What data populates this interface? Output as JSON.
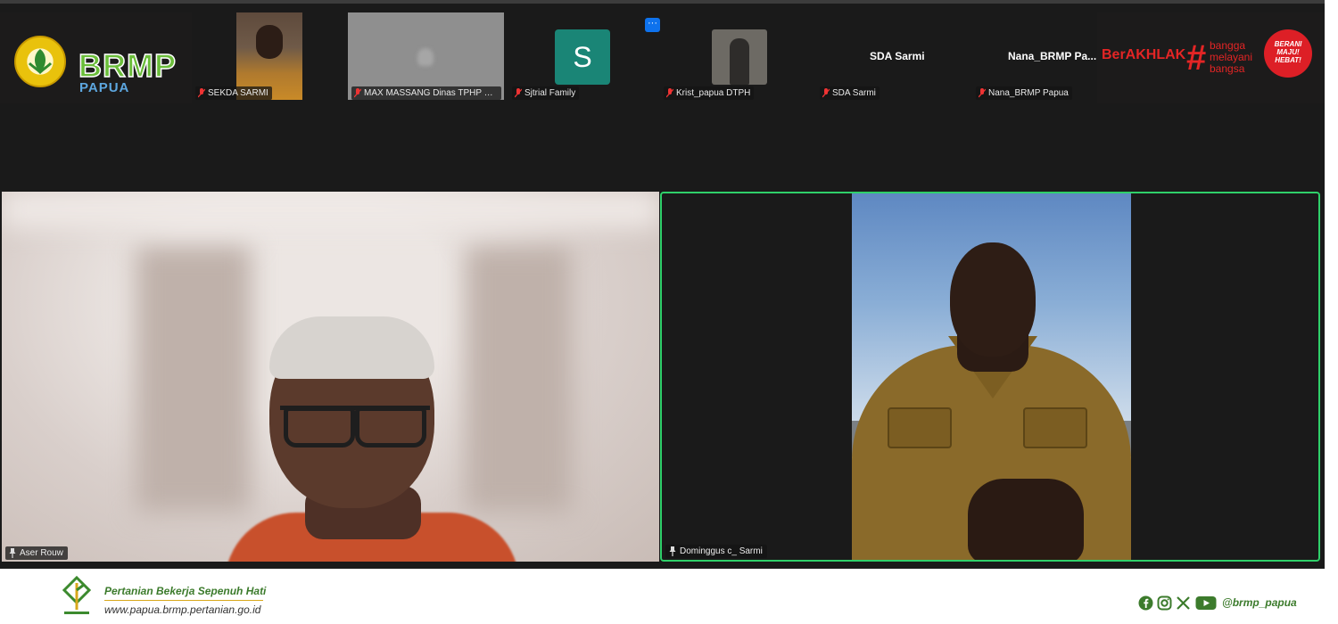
{
  "branding": {
    "left_logo": "BRMP",
    "left_sub": "PAPUA",
    "right_berakhlak": "BerAKHLAK",
    "right_bangga": [
      "bangga",
      "melayani",
      "bangsa"
    ],
    "right_berani": [
      "BERANI",
      "MAJU!",
      "HEBAT!"
    ]
  },
  "participants": [
    {
      "name": "SEKDA SARMI",
      "muted": true,
      "video": "camera"
    },
    {
      "name": "MAX  MASSANG Dinas TPHP Pa...",
      "muted": true,
      "video": "camera-off"
    },
    {
      "name": "Sjtrial Family",
      "muted": true,
      "video": "avatar",
      "avatar_letter": "S"
    },
    {
      "name": "Krist_papua DTPH",
      "muted": true,
      "video": "thumbnail"
    },
    {
      "name": "SDA Sarmi",
      "muted": true,
      "video": "name-only",
      "display_label": "SDA Sarmi"
    },
    {
      "name": "Nana_BRMP Papua",
      "muted": true,
      "video": "name-only",
      "display_label": "Nana_BRMP  Pa..."
    }
  ],
  "more_button": "···",
  "main_tiles": [
    {
      "name": "Aser Rouw",
      "pinned": true,
      "active_speaker": false
    },
    {
      "name": "Dominggus c_ Sarmi",
      "pinned": true,
      "active_speaker": true
    }
  ],
  "footer": {
    "tagline": "Pertanian Bekerja Sepenuh Hati",
    "website": "www.papua.brmp.pertanian.go.id",
    "handle": "@brmp_papua",
    "socials": [
      "facebook-icon",
      "instagram-icon",
      "x-icon",
      "youtube-icon"
    ]
  },
  "colors": {
    "active_speaker_border": "#2fd06a",
    "brand_green": "#3c7b2c",
    "accent_red": "#e32525",
    "avatar_teal": "#1a8576",
    "zoom_blue": "#0e72ed"
  }
}
